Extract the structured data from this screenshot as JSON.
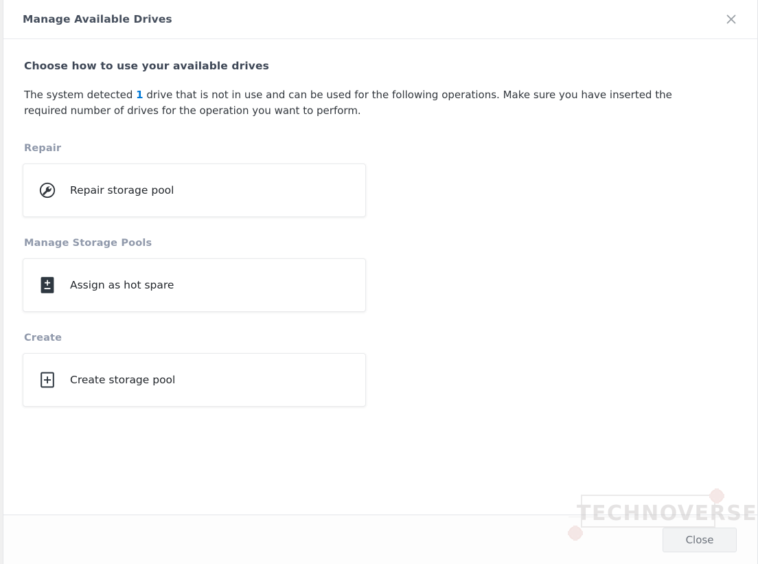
{
  "dialog": {
    "title": "Manage Available Drives",
    "close_icon": "close-icon"
  },
  "content": {
    "heading": "Choose how to use your available drives",
    "intro_before": "The system detected ",
    "intro_count": "1",
    "intro_after": " drive that is not in use and can be used for the following operations. Make sure you have inserted the required number of drives for the operation you want to perform.",
    "groups": [
      {
        "label": "Repair",
        "options": [
          {
            "icon": "wrench-circle-icon",
            "label": "Repair storage pool"
          }
        ]
      },
      {
        "label": "Manage Storage Pools",
        "options": [
          {
            "icon": "hot-spare-icon",
            "label": "Assign as hot spare"
          }
        ]
      },
      {
        "label": "Create",
        "options": [
          {
            "icon": "plus-square-icon",
            "label": "Create storage pool"
          }
        ]
      }
    ]
  },
  "footer": {
    "close_label": "Close"
  },
  "watermark": {
    "text": "TECHNOVERSE"
  },
  "colors": {
    "accent": "#0078d7",
    "group_label": "#9099ab",
    "title": "#464f5d",
    "body_text": "#32373d"
  }
}
